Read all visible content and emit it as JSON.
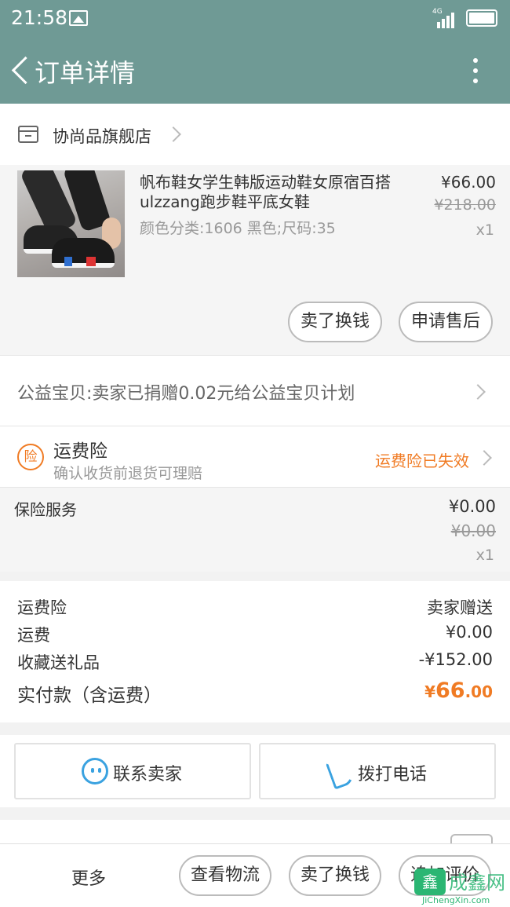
{
  "status_bar": {
    "time": "21:58",
    "network": "4G"
  },
  "header": {
    "title": "订单详情"
  },
  "shop": {
    "name": "协尚品旗舰店"
  },
  "product": {
    "title": "帆布鞋女学生韩版运动鞋女原宿百搭ulzzang跑步鞋平底女鞋",
    "sku": "颜色分类:1606 黑色;尺码:35",
    "price": "¥66.00",
    "original_price": "¥218.00",
    "quantity": "x1",
    "actions": {
      "sell": "卖了换钱",
      "after_sale": "申请售后"
    }
  },
  "charity": {
    "text": "公益宝贝:卖家已捐赠0.02元给公益宝贝计划"
  },
  "shipping_insurance": {
    "badge": "险",
    "title": "运费险",
    "subtitle": "确认收货前退货可理赔",
    "status": "运费险已失效"
  },
  "insurance_service": {
    "label": "保险服务",
    "price": "¥0.00",
    "original_price": "¥0.00",
    "quantity": "x1"
  },
  "summary": {
    "rows": [
      {
        "label": "运费险",
        "value": "卖家赠送"
      },
      {
        "label": "运费",
        "value": "¥0.00"
      },
      {
        "label": "收藏送礼品",
        "value": "-¥152.00"
      }
    ],
    "total_label": "实付款（含运费）",
    "total_currency": "¥",
    "total_integer": "66",
    "total_decimal": ".00"
  },
  "contact": {
    "seller": "联系卖家",
    "call": "拨打电话"
  },
  "bottom_bar": {
    "more": "更多",
    "logistics": "查看物流",
    "sell": "卖了换钱",
    "review": "追加评价"
  },
  "watermark": {
    "cn": "成鑫网",
    "en": "JiChengXin.com",
    "logo": "鑫"
  },
  "colors": {
    "header": "#6f9a95",
    "accent": "#f07b24",
    "icon_blue": "#3aa2e0"
  }
}
